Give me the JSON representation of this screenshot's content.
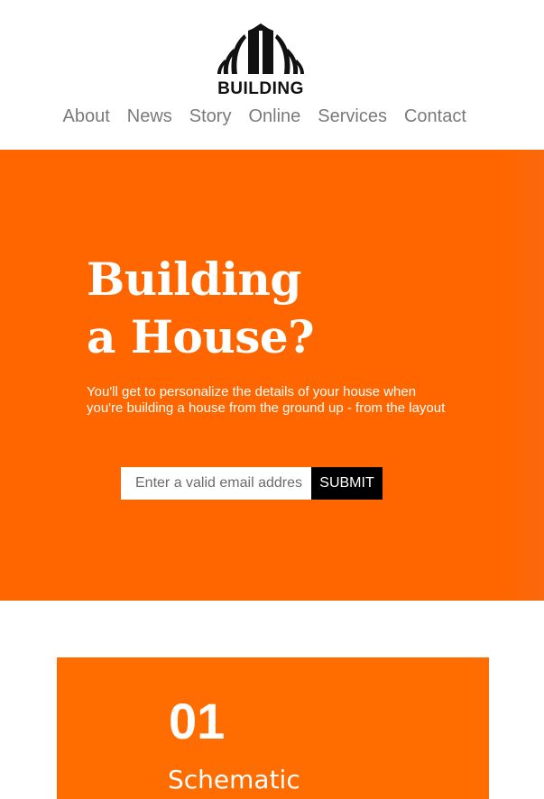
{
  "brand": {
    "name": "BUILDING",
    "logo_icon": "building-logo-icon"
  },
  "nav": {
    "items": [
      {
        "label": "About"
      },
      {
        "label": "News"
      },
      {
        "label": "Story"
      },
      {
        "label": "Online"
      },
      {
        "label": "Services"
      },
      {
        "label": "Contact"
      }
    ]
  },
  "hero": {
    "title_line1": "Building",
    "title_line2": "a House?",
    "description": "You'll get to personalize the details of your house when you're building a house from the ground up - from the layout",
    "email_placeholder": "Enter a valid email address",
    "submit_label": "SUBMIT",
    "background_color": "#ff6600"
  },
  "card": {
    "number": "01",
    "title": "Schematic",
    "background_color": "#ff6d00"
  }
}
